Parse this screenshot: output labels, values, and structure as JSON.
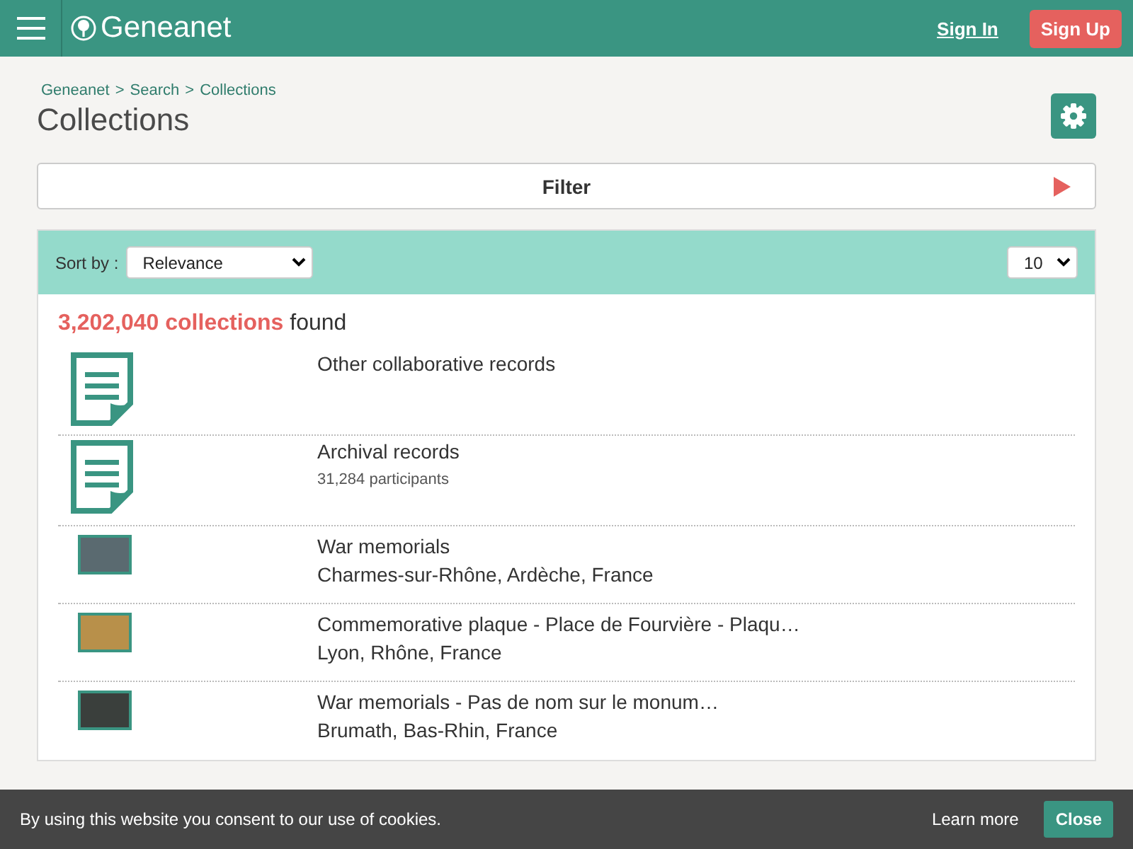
{
  "header": {
    "logo": "Geneanet",
    "sign_in": "Sign In",
    "sign_up": "Sign Up"
  },
  "breadcrumb": [
    "Geneanet",
    "Search",
    "Collections"
  ],
  "breadcrumb_separator": ">",
  "title": "Collections",
  "filter": {
    "label": "Filter",
    "expanded": false
  },
  "sort": {
    "label": "Sort by :",
    "value": "Relevance",
    "per_page": "10"
  },
  "results": {
    "count": "3,202,040 collections",
    "suffix": "found"
  },
  "items": [
    {
      "kind": "document",
      "title": "Other collaborative records"
    },
    {
      "kind": "document",
      "title": "Archival records",
      "detail": "31,284 participants"
    },
    {
      "kind": "photo",
      "title": "War memorials",
      "place": "Charmes-sur-Rhône, Ardèche, France",
      "color": "#5a6a70"
    },
    {
      "kind": "photo",
      "title": "Commemorative plaque - Place de Fourvière - Plaqu…",
      "place": "Lyon, Rhône, France",
      "color": "#b8904a"
    },
    {
      "kind": "photo",
      "title": "War memorials - Pas de nom sur le monum…",
      "place": "Brumath, Bas-Rhin, France",
      "color": "#3a3f3c"
    }
  ],
  "cookie_bar": {
    "text": "By using this website you consent to our use of cookies.",
    "learn_more": "Learn more",
    "close": "Close"
  }
}
